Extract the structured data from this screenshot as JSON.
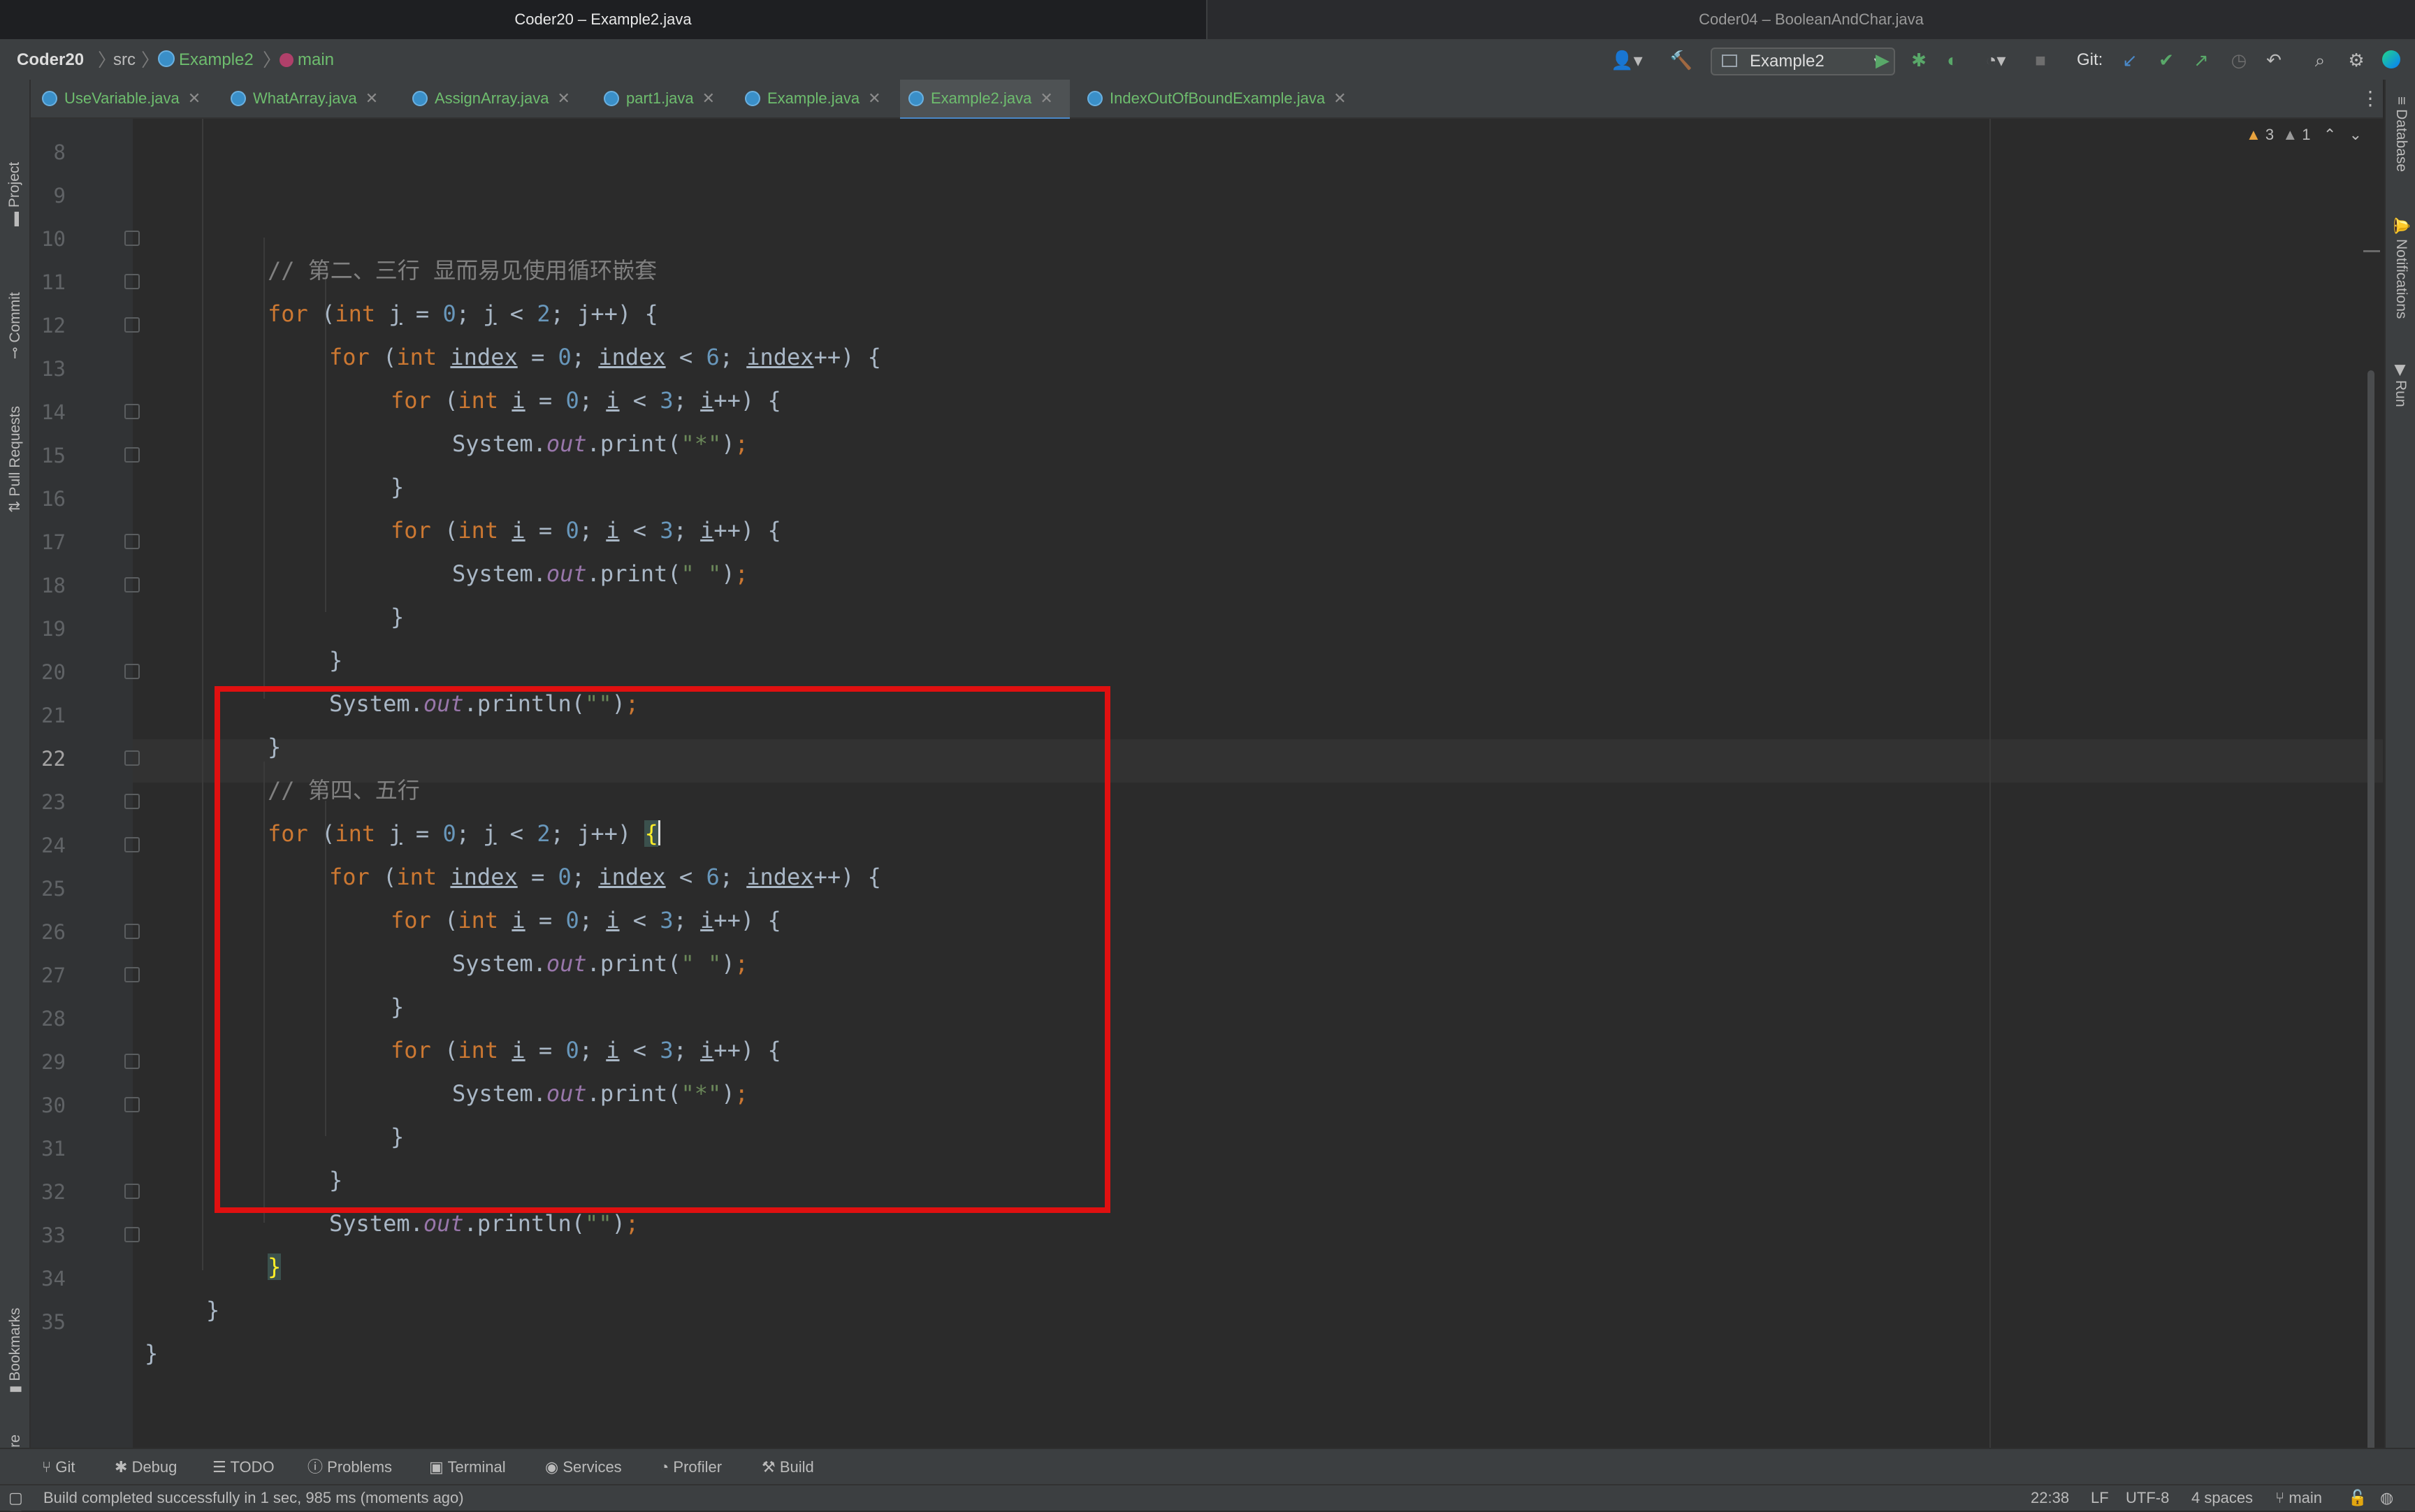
{
  "window": {
    "active_title": "Coder20 – Example2.java",
    "inactive_title": "Coder04 – BooleanAndChar.java"
  },
  "navbar": {
    "project": "Coder20",
    "folder": "src",
    "class": "Example2",
    "method": "main",
    "run_config": "Example2",
    "git_label": "Git:"
  },
  "tabs": [
    {
      "label": "UseVariable.java"
    },
    {
      "label": "WhatArray.java"
    },
    {
      "label": "AssignArray.java"
    },
    {
      "label": "part1.java"
    },
    {
      "label": "Example.java"
    },
    {
      "label": "Example2.java",
      "active": true
    },
    {
      "label": "IndexOutOfBoundExample.java"
    }
  ],
  "left_toolwindows": [
    "Project",
    "Commit",
    "Pull Requests",
    "Bookmarks",
    "Structure"
  ],
  "right_toolwindows": [
    "Database",
    "Notifications",
    "Run"
  ],
  "inspections": {
    "warnings": "3",
    "weak_warnings": "1"
  },
  "editor": {
    "current_line": 22,
    "line_numbers": [
      "8",
      "9",
      "10",
      "11",
      "12",
      "13",
      "14",
      "15",
      "16",
      "17",
      "18",
      "19",
      "20",
      "21",
      "22",
      "23",
      "24",
      "25",
      "26",
      "27",
      "28",
      "29",
      "30",
      "31",
      "32",
      "33",
      "34",
      "35"
    ]
  },
  "bottom_tools": [
    "Git",
    "Debug",
    "TODO",
    "Problems",
    "Terminal",
    "Services",
    "Profiler",
    "Build"
  ],
  "status": {
    "message": "Build completed successfully in 1 sec, 985 ms (moments ago)",
    "position": "22:38",
    "line_sep": "LF",
    "encoding": "UTF-8",
    "indent": "4 spaces",
    "branch": "main"
  }
}
